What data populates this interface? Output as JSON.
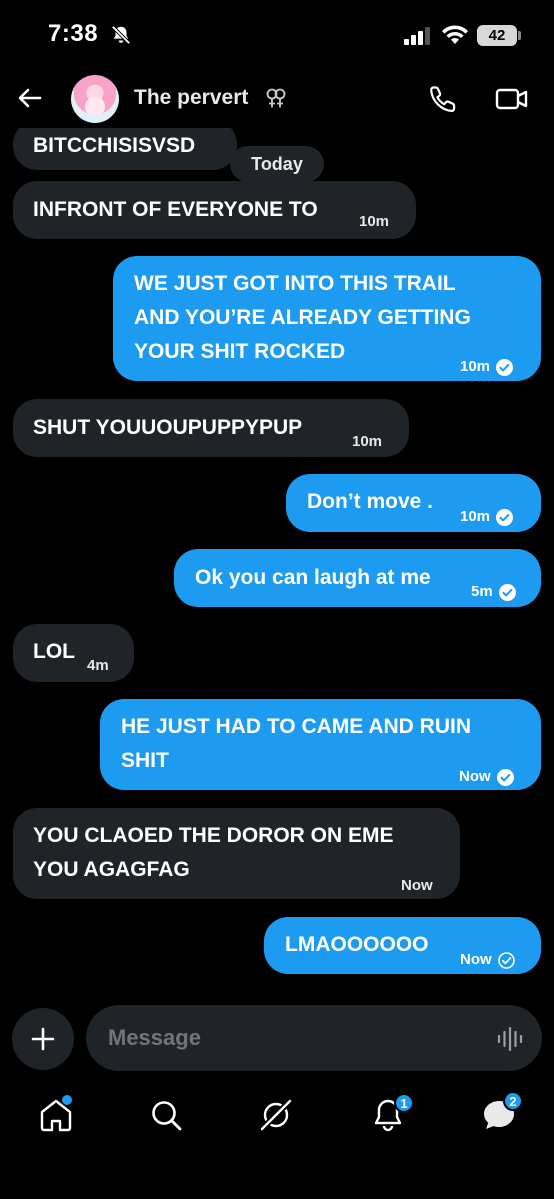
{
  "status_bar": {
    "time": "7:38",
    "battery": "42"
  },
  "header": {
    "contact_name": "The pervert"
  },
  "chat": {
    "day_label": "Today",
    "messages": [
      {
        "dir": "in",
        "text": "BITCCHISISVSD",
        "time": ""
      },
      {
        "dir": "in",
        "text": "INFRONT OF EVERYONE TO",
        "time": "10m"
      },
      {
        "dir": "out",
        "lines": [
          "WE JUST GOT INTO THIS TRAIL",
          "AND YOU’RE ALREADY GETTING",
          "YOUR SHIT ROCKED"
        ],
        "time": "10m",
        "status": "read"
      },
      {
        "dir": "in",
        "text": "SHUT YOUUOUPUPPYPUP",
        "time": "10m"
      },
      {
        "dir": "out",
        "text": "Don’t move .",
        "time": "10m",
        "status": "read"
      },
      {
        "dir": "out",
        "text": "Ok you can laugh at me",
        "time": "5m",
        "status": "read"
      },
      {
        "dir": "in",
        "text": "LOL",
        "time": "4m"
      },
      {
        "dir": "out",
        "lines": [
          "HE JUST HAD TO CAME AND RUIN",
          "SHIT"
        ],
        "time": "Now",
        "status": "read"
      },
      {
        "dir": "in",
        "lines": [
          "YOU CLAOED THE DOROR ON EME",
          "YOU AGAGFAG"
        ],
        "time": "Now"
      },
      {
        "dir": "out",
        "text": "LMAOOOOOO",
        "time": "Now",
        "status": "sent"
      }
    ]
  },
  "composer": {
    "placeholder": "Message"
  },
  "bottom_nav": {
    "items": [
      {
        "icon": "home-icon",
        "dot": true
      },
      {
        "icon": "search-icon"
      },
      {
        "icon": "grok-icon"
      },
      {
        "icon": "bell-icon",
        "badge": "1"
      },
      {
        "icon": "messages-icon",
        "badge": "2"
      }
    ]
  },
  "colors": {
    "accent": "#1d9bf0",
    "incoming_bubble": "#202327",
    "background": "#000000"
  }
}
